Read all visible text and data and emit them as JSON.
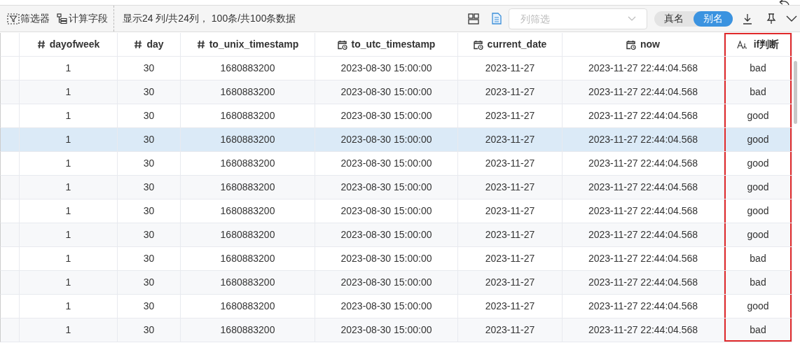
{
  "toolbar": {
    "filter_button": "筛选器",
    "computed_field_button": "计算字段",
    "summary": "显示24 列/共24列， 100条/共100条数据",
    "column_filter": {
      "placeholder": "列筛选"
    },
    "name_toggle": [
      {
        "label": "真名",
        "selected": false
      },
      {
        "label": "别名",
        "selected": true
      }
    ]
  },
  "table": {
    "columns": [
      {
        "label": "dayofweek",
        "kind": "number",
        "highlighted": false
      },
      {
        "label": "day",
        "kind": "number",
        "highlighted": false
      },
      {
        "label": "to_unix_timestamp",
        "kind": "number",
        "highlighted": false
      },
      {
        "label": "to_utc_timestamp",
        "kind": "datetime",
        "highlighted": false
      },
      {
        "label": "current_date",
        "kind": "datetime",
        "highlighted": false
      },
      {
        "label": "now",
        "kind": "datetime",
        "highlighted": false
      },
      {
        "label": "if判断",
        "kind": "text",
        "highlighted": true
      }
    ],
    "rows": [
      {
        "selected": false,
        "cells": [
          "1",
          "30",
          "1680883200",
          "2023-08-30 15:00:00",
          "2023-11-27",
          "2023-11-27 22:44:04.568",
          "bad"
        ]
      },
      {
        "selected": false,
        "cells": [
          "1",
          "30",
          "1680883200",
          "2023-08-30 15:00:00",
          "2023-11-27",
          "2023-11-27 22:44:04.568",
          "bad"
        ]
      },
      {
        "selected": false,
        "cells": [
          "1",
          "30",
          "1680883200",
          "2023-08-30 15:00:00",
          "2023-11-27",
          "2023-11-27 22:44:04.568",
          "good"
        ]
      },
      {
        "selected": true,
        "cells": [
          "1",
          "30",
          "1680883200",
          "2023-08-30 15:00:00",
          "2023-11-27",
          "2023-11-27 22:44:04.568",
          "good"
        ]
      },
      {
        "selected": false,
        "cells": [
          "1",
          "30",
          "1680883200",
          "2023-08-30 15:00:00",
          "2023-11-27",
          "2023-11-27 22:44:04.568",
          "good"
        ]
      },
      {
        "selected": false,
        "cells": [
          "1",
          "30",
          "1680883200",
          "2023-08-30 15:00:00",
          "2023-11-27",
          "2023-11-27 22:44:04.568",
          "good"
        ]
      },
      {
        "selected": false,
        "cells": [
          "1",
          "30",
          "1680883200",
          "2023-08-30 15:00:00",
          "2023-11-27",
          "2023-11-27 22:44:04.568",
          "good"
        ]
      },
      {
        "selected": false,
        "cells": [
          "1",
          "30",
          "1680883200",
          "2023-08-30 15:00:00",
          "2023-11-27",
          "2023-11-27 22:44:04.568",
          "good"
        ]
      },
      {
        "selected": false,
        "cells": [
          "1",
          "30",
          "1680883200",
          "2023-08-30 15:00:00",
          "2023-11-27",
          "2023-11-27 22:44:04.568",
          "bad"
        ]
      },
      {
        "selected": false,
        "cells": [
          "1",
          "30",
          "1680883200",
          "2023-08-30 15:00:00",
          "2023-11-27",
          "2023-11-27 22:44:04.568",
          "bad"
        ]
      },
      {
        "selected": false,
        "cells": [
          "1",
          "30",
          "1680883200",
          "2023-08-30 15:00:00",
          "2023-11-27",
          "2023-11-27 22:44:04.568",
          "good"
        ]
      },
      {
        "selected": false,
        "cells": [
          "1",
          "30",
          "1680883200",
          "2023-08-30 15:00:00",
          "2023-11-27",
          "2023-11-27 22:44:04.568",
          "bad"
        ]
      }
    ]
  }
}
